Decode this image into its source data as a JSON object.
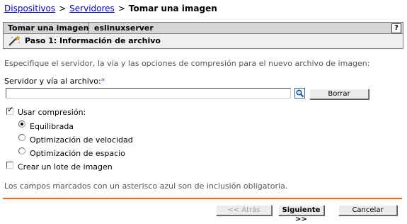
{
  "breadcrumb": {
    "item1": "Dispositivos",
    "item2": "Servidores",
    "current": "Tomar una imagen",
    "separator": ">"
  },
  "titlebar": {
    "title": "Tomar una imagen",
    "server": "eslinuxserver",
    "help": "?"
  },
  "step": {
    "label": "Paso 1: Información de archivo"
  },
  "form": {
    "description": "Especifique el servidor, la vía y las opciones de compresión para el nuevo archivo de imagen:",
    "path_label": "Servidor y vía al archivo:",
    "required_marker": "*",
    "path_value": "",
    "clear_button": "Borrar",
    "compression_label": "Usar compresión:",
    "compression_checked": true,
    "options": [
      {
        "label": "Equilibrada",
        "selected": true
      },
      {
        "label": "Optimización de velocidad",
        "selected": false
      },
      {
        "label": "Optimización de espacio",
        "selected": false
      }
    ],
    "batch_label": "Crear un lote de imagen",
    "batch_checked": false,
    "required_note": "Los campos marcados con un asterisco azul son de inclusión obligatoria."
  },
  "nav": {
    "back": "<< Atrás",
    "next": "Siguiente >>",
    "cancel": "Cancelar"
  },
  "colors": {
    "accent_line": "#e07020",
    "link": "#0000cc",
    "required": "#2a5db0"
  }
}
